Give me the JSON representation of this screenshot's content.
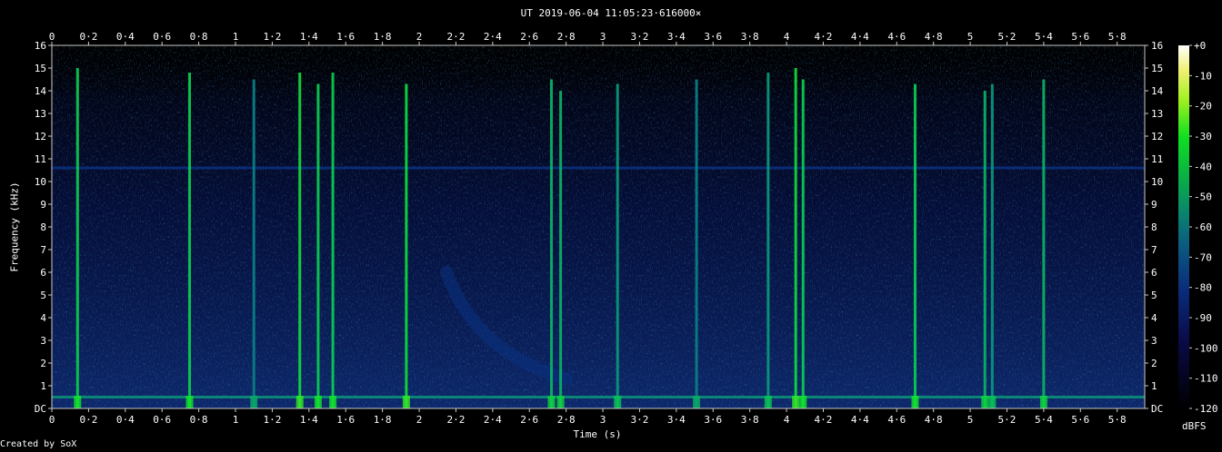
{
  "chart_data": {
    "type": "heatmap",
    "title": "UT 2019-06-04 11:05:23·616000×",
    "xlabel": "Time (s)",
    "ylabel": "Frequency (kHz)",
    "xlim": [
      0,
      5.95
    ],
    "ylim": [
      0,
      16
    ],
    "x_ticks": [
      "0",
      "0·2",
      "0·4",
      "0·6",
      "0·8",
      "1",
      "1·2",
      "1·4",
      "1·6",
      "1·8",
      "2",
      "2·2",
      "2·4",
      "2·6",
      "2·8",
      "3",
      "3·2",
      "3·4",
      "3·6",
      "3·8",
      "4",
      "4·2",
      "4·4",
      "4·6",
      "4·8",
      "5",
      "5·2",
      "5·4",
      "5·6",
      "5·8"
    ],
    "y_ticks": [
      "DC",
      "1",
      "2",
      "3",
      "4",
      "5",
      "6",
      "7",
      "8",
      "9",
      "10",
      "11",
      "12",
      "13",
      "14",
      "15",
      "16"
    ],
    "colorbar": {
      "label": "dBFS",
      "ticks": [
        "+0",
        "-10",
        "-20",
        "-30",
        "-40",
        "-50",
        "-60",
        "-70",
        "-80",
        "-90",
        "-100",
        "-110",
        "-120"
      ],
      "range": [
        -120,
        0
      ]
    },
    "transients": [
      {
        "t": 0.14,
        "fmax": 15.0,
        "level": -60
      },
      {
        "t": 0.75,
        "fmax": 14.8,
        "level": -60
      },
      {
        "t": 1.1,
        "fmax": 14.5,
        "level": -75
      },
      {
        "t": 1.35,
        "fmax": 14.8,
        "level": -55
      },
      {
        "t": 1.45,
        "fmax": 14.3,
        "level": -60
      },
      {
        "t": 1.53,
        "fmax": 14.8,
        "level": -60
      },
      {
        "t": 1.93,
        "fmax": 14.3,
        "level": -55
      },
      {
        "t": 2.72,
        "fmax": 14.5,
        "level": -65
      },
      {
        "t": 2.77,
        "fmax": 14.0,
        "level": -65
      },
      {
        "t": 3.08,
        "fmax": 14.3,
        "level": -70
      },
      {
        "t": 3.51,
        "fmax": 14.5,
        "level": -75
      },
      {
        "t": 3.9,
        "fmax": 14.8,
        "level": -70
      },
      {
        "t": 4.05,
        "fmax": 15.0,
        "level": -55
      },
      {
        "t": 4.09,
        "fmax": 14.5,
        "level": -60
      },
      {
        "t": 4.7,
        "fmax": 14.3,
        "level": -60
      },
      {
        "t": 5.08,
        "fmax": 14.0,
        "level": -65
      },
      {
        "t": 5.12,
        "fmax": 14.3,
        "level": -70
      },
      {
        "t": 5.4,
        "fmax": 14.5,
        "level": -65
      }
    ],
    "horizontal_lines": [
      {
        "f": 0.5,
        "level": -70
      },
      {
        "f": 10.6,
        "level": -90
      }
    ],
    "chirp": {
      "t_start": 2.15,
      "f_start": 6.0,
      "t_end": 2.8,
      "f_end": 1.3,
      "level": -90
    }
  }
}
